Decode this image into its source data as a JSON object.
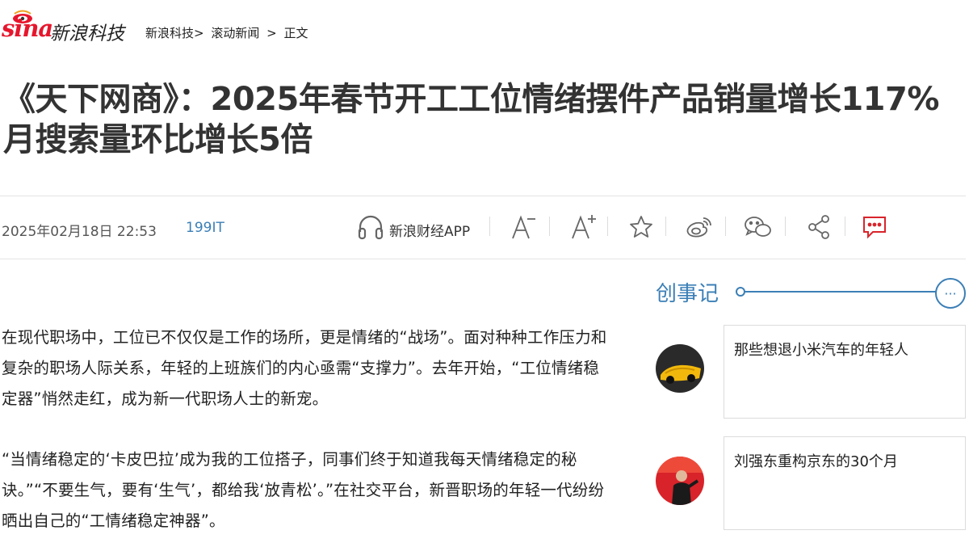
{
  "header": {
    "logo_word": "sina",
    "logo_cn": "新浪科技",
    "breadcrumb": [
      "新浪科技>",
      "滚动新闻",
      ">",
      "正文"
    ]
  },
  "article": {
    "title": "《天下网商》：2025年春节开工工位情绪摆件产品销量增长117% 月搜索量环比增长5倍",
    "date": "2025年02月18日 22:53",
    "source": "199IT",
    "paragraphs": [
      "在现代职场中，工位已不仅仅是工作的场所，更是情绪的“战场”。面对种种工作压力和复杂的职场人际关系，年轻的上班族们的内心亟需“支撑力”。去年开始，“工位情绪稳定器”悄然走红，成为新一代职场人士的新宠。",
      "“当情绪稳定的‘卡皮巴拉’成为我的工位搭子，同事们终于知道我每天情绪稳定的秘诀。”“不要生气，要有‘生气’，都给我‘放青松’。”在社交平台，新晋职场的年轻一代纷纷晒出自己的“工情绪稳定神器”。"
    ]
  },
  "toolbar": {
    "app_label": "新浪财经APP",
    "icons": [
      "headphones-icon",
      "font-decrease-icon",
      "font-increase-icon",
      "star-icon",
      "weibo-icon",
      "wechat-icon",
      "share-icon",
      "comment-icon"
    ]
  },
  "sidebar": {
    "title": "创事记",
    "more": "···",
    "cards": [
      {
        "title": "那些想退小米汽车的年轻人"
      },
      {
        "title": "刘强东重构京东的30个月"
      }
    ]
  },
  "colors": {
    "brand_red": "#e6162d",
    "link_blue": "#3b7fb6",
    "comment_red": "#d9242b"
  }
}
